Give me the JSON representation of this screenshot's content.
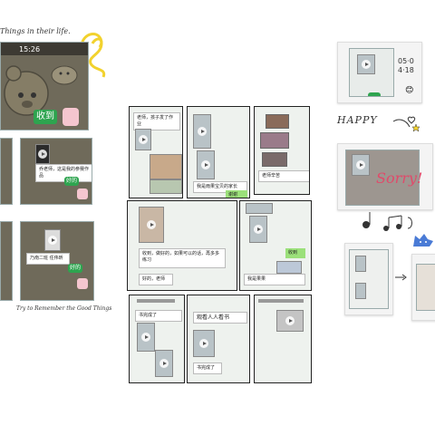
{
  "left_collage": {
    "caption_top": "Things in their life.",
    "phone_time": "15:26",
    "receive_button": "收到",
    "tiles": [
      {
        "text": "乔老师，这是我的参赛作品"
      },
      {
        "text": "好的"
      },
      {
        "text": "乃南二班 任伟昕"
      },
      {
        "text": "好的"
      }
    ],
    "caption_bottom": "Try to Remember the Good Things"
  },
  "middle_collage": {
    "panel_texts": [
      "老师，孩子发了作业",
      "我是雨果宝贝的家长",
      "谢谢",
      "收到，做好的，如果可以的话，再多多练习",
      "好的，老师",
      "老师辛苦",
      "收到",
      "我是果果",
      "观看人人看书",
      "书完成了"
    ]
  },
  "right_collage": {
    "date_text": "05·04·18",
    "happy_text": "HAPPY",
    "sorry_text": "Sorry!",
    "emoji_badge": "😊"
  },
  "colors": {
    "wechat_green": "#2ea44f",
    "chat_bubble_green": "#9be07a",
    "doodle_yellow": "#f2d22e",
    "doodle_blue": "#4a7bd6"
  }
}
